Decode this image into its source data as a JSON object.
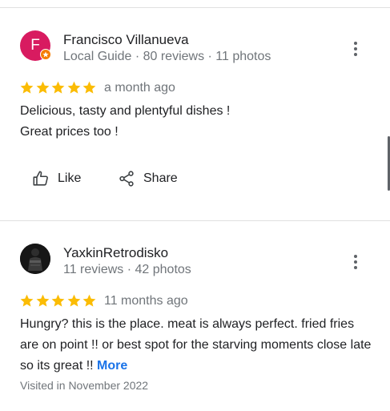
{
  "reviews": [
    {
      "author": "Francisco Villanueva",
      "avatar_letter": "F",
      "avatar_color": "#d81b60",
      "meta": "Local Guide · 80 reviews · 11 photos",
      "rating": 5,
      "time": "a month ago",
      "text_lines": [
        "Delicious, tasty and plentyful dishes !",
        "Great prices too !"
      ],
      "actions": {
        "like": "Like",
        "share": "Share"
      }
    },
    {
      "author": "YaxkinRetrodisko",
      "meta": "11 reviews · 42 photos",
      "rating": 5,
      "time": "11 months ago",
      "text": "Hungry?  this is the place.   meat is always perfect. fried fries are on point !!  or best spot for the starving moments   close late so its great !! ",
      "more": "More",
      "visited": "Visited in November 2022"
    }
  ],
  "colors": {
    "star": "#fbbc04",
    "link": "#1a73e8",
    "muted": "#70757a"
  },
  "icons": [
    "local-guide-badge-icon",
    "more-vert-icon",
    "star-icon",
    "thumb-up-icon",
    "share-icon"
  ]
}
